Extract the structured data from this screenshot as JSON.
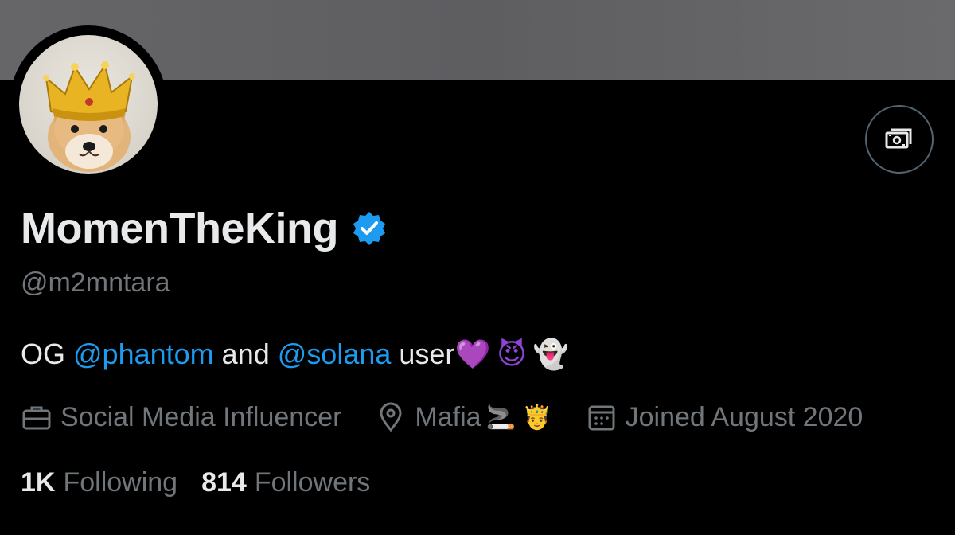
{
  "profile": {
    "display_name": "MomenTheKing",
    "handle": "@m2mntara",
    "verified": true,
    "avatar_icon": "shiba-dog-crown-avatar",
    "tip_icon": "money-tips-icon"
  },
  "bio": {
    "prefix": "OG ",
    "mention1": "@phantom",
    "middle": " and ",
    "mention2": "@solana",
    "suffix": " user",
    "emoji_heart": "💜",
    "emoji_devil": "😈",
    "emoji_ghost": "👻"
  },
  "meta": {
    "category": "Social Media Influencer",
    "location": "Mafia",
    "location_emoji": "🚬 🤴",
    "joined": "Joined August 2020"
  },
  "stats": {
    "following_count": "1K",
    "following_label": "Following",
    "followers_count": "814",
    "followers_label": "Followers"
  },
  "colors": {
    "background": "#000000",
    "text_primary": "#e7e9ea",
    "text_secondary": "#71767b",
    "accent_blue": "#1d9bf0",
    "banner": "#646466"
  }
}
